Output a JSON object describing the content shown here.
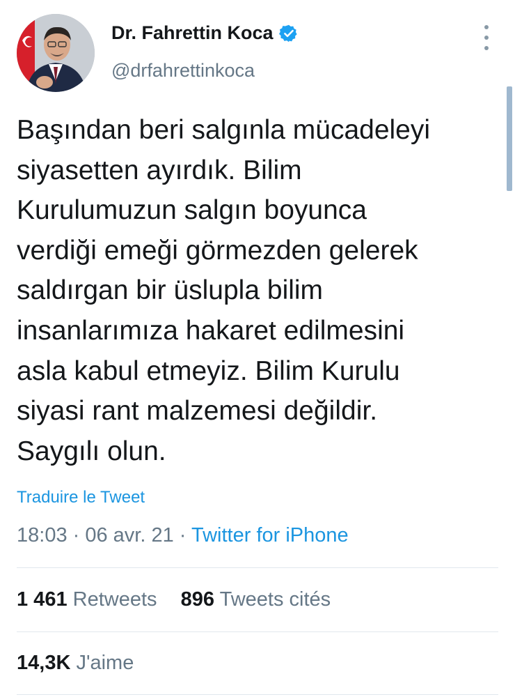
{
  "author": {
    "display_name": "Dr. Fahrettin Koca",
    "handle": "@drfahrettinkoca",
    "verified": true
  },
  "tweet": {
    "lines": [
      "Başından beri salgınla mücadeleyi",
      "siyasetten ayırdık. Bilim",
      "Kurulumuzun salgın boyunca",
      "verdiği emeği görmezden gelerek",
      "saldırgan bir üslupla bilim",
      "insanlarımıza hakaret edilmesini",
      "asla kabul etmeyiz. Bilim Kurulu",
      "siyasi rant malzemesi değildir.",
      "Saygılı olun."
    ]
  },
  "translate_label": "Traduire le Tweet",
  "meta": {
    "time": "18:03",
    "separator": " · ",
    "date": "06 avr. 21",
    "source": "Twitter for iPhone"
  },
  "stats": {
    "retweets_count": "1 461",
    "retweets_label": "Retweets",
    "quotes_count": "896",
    "quotes_label": "Tweets cités",
    "likes_count": "14,3K",
    "likes_label": "J'aime"
  },
  "colors": {
    "link": "#1b95e0",
    "muted": "#657786",
    "text": "#14171a",
    "verified": "#1da1f2"
  },
  "icons": {
    "verified": "verified-badge-icon",
    "more": "more-options-icon"
  }
}
